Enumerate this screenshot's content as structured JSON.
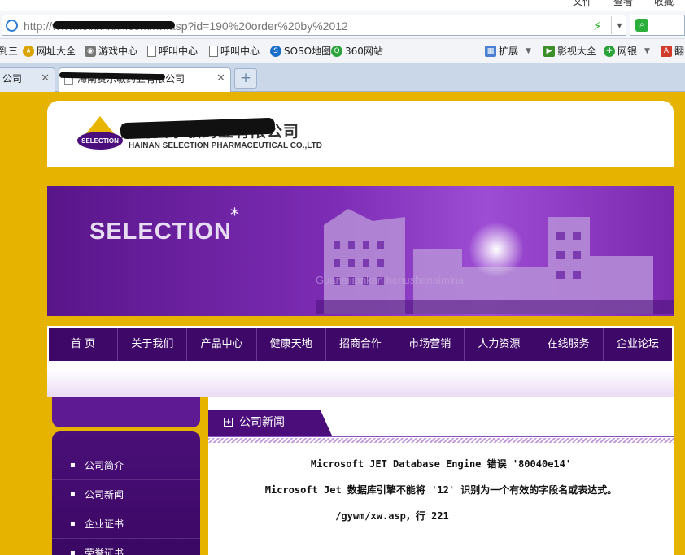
{
  "browser": {
    "menu": [
      "文件",
      "查看",
      "收藏"
    ],
    "address": "http://www.xxxxxxxx.com/xw.asp?id=190%20order%20by%2012",
    "bookmarks": [
      "到三",
      "网址大全",
      "游戏中心",
      "呼叫中心",
      "呼叫中心",
      "SOSO地图",
      "360网站"
    ],
    "bookmarks_right": [
      "扩展",
      "影视大全",
      "网银",
      "翻"
    ],
    "tabs": [
      {
        "label": "公司"
      },
      {
        "label": "海南赛乐敏药业有限公司"
      }
    ],
    "new_tab": "+"
  },
  "site": {
    "logo_cn": "海南赛乐敏药业有限公司",
    "logo_en": "HAINAN SELECTION PHARMACEUTICAL CO.,LTD",
    "logo_mark": "SELECTION",
    "banner_title": "SELECTION",
    "banner_star": "*",
    "banner_sub": "Guanaiiiankan henushenaimina",
    "nav": [
      "首  页",
      "关于我们",
      "产品中心",
      "健康天地",
      "招商合作",
      "市场营销",
      "人力资源",
      "在线服务",
      "企业论坛"
    ],
    "left_menu": [
      "公司简介",
      "公司新闻",
      "企业证书",
      "荣誉证书"
    ],
    "section_title": "公司新闻",
    "section_plus": "+",
    "error": {
      "line1": "Microsoft JET Database Engine 错误 '80040e14'",
      "line2": "Microsoft Jet 数据库引擎不能将 '12' 识别为一个有效的字段名或表达式。",
      "line3": "/gywm/xw.asp，行 221"
    }
  },
  "colors": {
    "site_bg": "#e6b400",
    "nav_bg": "#3e0868",
    "banner_purple": "#7c2cb4",
    "error_text": "#111111"
  }
}
